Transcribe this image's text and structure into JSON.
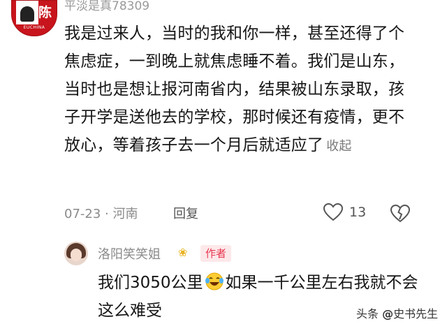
{
  "comment": {
    "username": "平淡是真78309",
    "avatar_brand": "EUCHINA",
    "avatar_glyph": "陈",
    "text": "我是过来人，当时的我和你一样，甚至还得了个焦虑症，一到晚上就焦虑睡不着。我们是山东，当时也是想让报河南省内，结果被山东录取，孩子开学是送他去的学校，那时候还有疫情，更不放心，等着孩子去一个月后就适应了",
    "collapse_label": "收起",
    "date": "07-23",
    "separator": "·",
    "location": "河南",
    "reply_label": "回复",
    "like_count": "13"
  },
  "reply": {
    "username": "洛阳笑笑姐",
    "badge": "作者",
    "text_before": "我们3050公里",
    "text_after": "如果一千公里左右我就不会这么难受"
  },
  "watermark": {
    "label": "头条",
    "at": "@",
    "name": "史书先生"
  },
  "colors": {
    "badge_text": "#e8384f",
    "badge_bg": "#fde8ea",
    "avatar_red": "#c8141c"
  }
}
